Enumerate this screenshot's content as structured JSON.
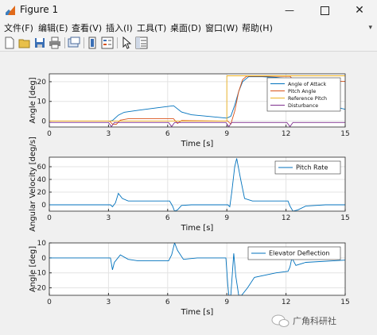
{
  "window": {
    "title": "Figure 1"
  },
  "menu": [
    "文件(F)",
    "编辑(E)",
    "查看(V)",
    "插入(I)",
    "工具(T)",
    "桌面(D)",
    "窗口(W)",
    "帮助(H)"
  ],
  "toolbar_icons": [
    "new-figure-icon",
    "open-file-icon",
    "save-icon",
    "print-icon",
    "link-plot-icon",
    "colorbar-icon",
    "legend-icon",
    "pointer-icon",
    "property-inspector-icon"
  ],
  "watermark": "广角科研社",
  "colors": {
    "blue": "#0072bd",
    "orange": "#d95319",
    "yellow": "#edb120",
    "purple": "#7e2f8e"
  },
  "chart_data": [
    {
      "type": "line",
      "xlabel": "Time [s]",
      "ylabel": "Angle [deg]",
      "xlim": [
        0,
        15
      ],
      "ylim": [
        -3,
        24
      ],
      "xticks": [
        0,
        3,
        6,
        9,
        12,
        15
      ],
      "yticks": [
        0,
        10,
        20
      ],
      "grid": true,
      "legend_position": "top-right",
      "series": [
        {
          "name": "Angle of Attack",
          "color": "#0072bd",
          "points": [
            [
              0,
              0
            ],
            [
              3.05,
              0
            ],
            [
              3.2,
              0.3
            ],
            [
              3.5,
              3
            ],
            [
              3.8,
              4.5
            ],
            [
              4.5,
              5.5
            ],
            [
              5.5,
              6.8
            ],
            [
              6.3,
              7.8
            ],
            [
              6.7,
              4.6
            ],
            [
              7.2,
              3.2
            ],
            [
              8,
              2.5
            ],
            [
              9,
              1.5
            ],
            [
              9.2,
              2.5
            ],
            [
              9.4,
              8
            ],
            [
              9.6,
              15
            ],
            [
              9.8,
              20
            ],
            [
              10.1,
              22.5
            ],
            [
              10.8,
              22.5
            ],
            [
              11.5,
              22.2
            ],
            [
              12.2,
              21.5
            ],
            [
              12.4,
              15.5
            ],
            [
              13,
              12
            ],
            [
              14,
              8.5
            ],
            [
              15,
              6
            ]
          ]
        },
        {
          "name": "Pitch Angle",
          "color": "#d95319",
          "points": [
            [
              0,
              0
            ],
            [
              3.05,
              0
            ],
            [
              3.2,
              -1.5
            ],
            [
              3.4,
              -1.6
            ],
            [
              3.6,
              0.5
            ],
            [
              4,
              1.2
            ],
            [
              6.3,
              1.2
            ],
            [
              6.5,
              -1.2
            ],
            [
              6.7,
              0.3
            ],
            [
              7.2,
              0.2
            ],
            [
              9.05,
              0
            ],
            [
              9.2,
              -1.5
            ],
            [
              9.4,
              5
            ],
            [
              9.6,
              15
            ],
            [
              9.8,
              21
            ],
            [
              10,
              22.8
            ],
            [
              12.2,
              22.8
            ],
            [
              12.4,
              20.5
            ],
            [
              15,
              20.2
            ]
          ]
        },
        {
          "name": "Reference Pitch",
          "color": "#edb120",
          "points": [
            [
              0,
              0
            ],
            [
              9,
              0
            ],
            [
              9,
              23
            ],
            [
              15,
              23
            ]
          ]
        },
        {
          "name": "Disturbance",
          "color": "#7e2f8e",
          "points": [
            [
              0,
              -0.7
            ],
            [
              3,
              -0.7
            ],
            [
              3.15,
              -2.8
            ],
            [
              3.3,
              -0.7
            ],
            [
              6.05,
              -0.7
            ],
            [
              6.2,
              -2.8
            ],
            [
              6.35,
              -0.7
            ],
            [
              8.95,
              -0.7
            ],
            [
              9.1,
              -2.8
            ],
            [
              9.25,
              -0.7
            ],
            [
              12.05,
              -0.7
            ],
            [
              12.2,
              -2.8
            ],
            [
              12.35,
              -0.7
            ],
            [
              15,
              -0.7
            ]
          ]
        }
      ]
    },
    {
      "type": "line",
      "xlabel": "Time [s]",
      "ylabel": "Angular Velocity [deg/s]",
      "xlim": [
        0,
        15
      ],
      "ylim": [
        -10,
        75
      ],
      "xticks": [
        0,
        3,
        6,
        9,
        12,
        15
      ],
      "yticks": [
        0,
        20,
        40,
        60
      ],
      "grid": true,
      "legend_position": "top-right",
      "series": [
        {
          "name": "Pitch Rate",
          "color": "#0072bd",
          "points": [
            [
              0,
              0
            ],
            [
              3.1,
              0
            ],
            [
              3.2,
              -3
            ],
            [
              3.35,
              3
            ],
            [
              3.5,
              18
            ],
            [
              3.7,
              10
            ],
            [
              4,
              6
            ],
            [
              6.1,
              6
            ],
            [
              6.25,
              -2
            ],
            [
              6.35,
              -10
            ],
            [
              6.5,
              -8
            ],
            [
              6.7,
              -1
            ],
            [
              7.2,
              0
            ],
            [
              9.05,
              0
            ],
            [
              9.15,
              -3
            ],
            [
              9.25,
              20
            ],
            [
              9.4,
              60
            ],
            [
              9.5,
              73
            ],
            [
              9.7,
              40
            ],
            [
              9.9,
              10
            ],
            [
              10.3,
              6
            ],
            [
              12.1,
              6
            ],
            [
              12.2,
              -2
            ],
            [
              12.35,
              -10
            ],
            [
              12.6,
              -8
            ],
            [
              13,
              -2
            ],
            [
              14,
              0
            ],
            [
              15,
              0
            ]
          ]
        }
      ]
    },
    {
      "type": "line",
      "xlabel": "Time [s]",
      "ylabel": "Angle [deg]",
      "xlim": [
        0,
        15
      ],
      "ylim": [
        -25,
        10
      ],
      "xticks": [
        0,
        3,
        6,
        9,
        12,
        15
      ],
      "yticks": [
        -20,
        -10,
        0,
        10
      ],
      "grid": true,
      "legend_position": "top-right",
      "series": [
        {
          "name": "Elevator Deflection",
          "color": "#0072bd",
          "points": [
            [
              0,
              0
            ],
            [
              3.1,
              0
            ],
            [
              3.2,
              -8
            ],
            [
              3.3,
              -3
            ],
            [
              3.6,
              2
            ],
            [
              4,
              -1
            ],
            [
              4.5,
              -2
            ],
            [
              6.05,
              -2
            ],
            [
              6.2,
              2
            ],
            [
              6.35,
              10
            ],
            [
              6.5,
              5
            ],
            [
              6.8,
              -1
            ],
            [
              7.5,
              0
            ],
            [
              8.95,
              0
            ],
            [
              9.05,
              -18
            ],
            [
              9.1,
              -25
            ],
            [
              9.2,
              -25
            ],
            [
              9.35,
              3
            ],
            [
              9.45,
              -12
            ],
            [
              9.6,
              -25
            ],
            [
              9.75,
              -25
            ],
            [
              10.05,
              -20
            ],
            [
              10.4,
              -13
            ],
            [
              11.5,
              -10
            ],
            [
              12.1,
              -9
            ],
            [
              12.2,
              -6
            ],
            [
              12.3,
              0
            ],
            [
              12.5,
              -5
            ],
            [
              13,
              -3
            ],
            [
              15,
              -1.5
            ]
          ]
        }
      ]
    }
  ]
}
